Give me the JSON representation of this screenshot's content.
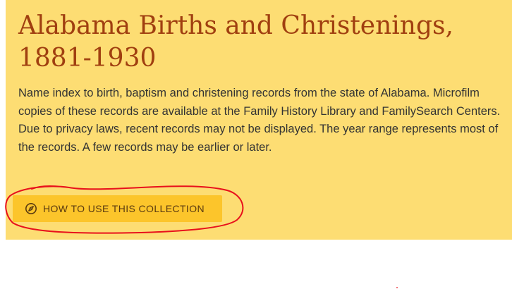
{
  "collection": {
    "title": "Alabama Births and Christenings, 1881-1930",
    "description": "Name index to birth, baptism and christening records from the state of Alabama. Microfilm copies of these records are available at the Family History Library and FamilySearch Centers. Due to privacy laws, recent records may not be displayed. The year range represents most of the records. A few records may be earlier or later.",
    "howto_button": {
      "label": "HOW TO USE THIS COLLECTION",
      "icon": "compass-icon"
    }
  },
  "colors": {
    "panel_background": "#fddd73",
    "title": "#a03f10",
    "button_background": "#fcc52b",
    "annotation_stroke": "#e8101b"
  }
}
